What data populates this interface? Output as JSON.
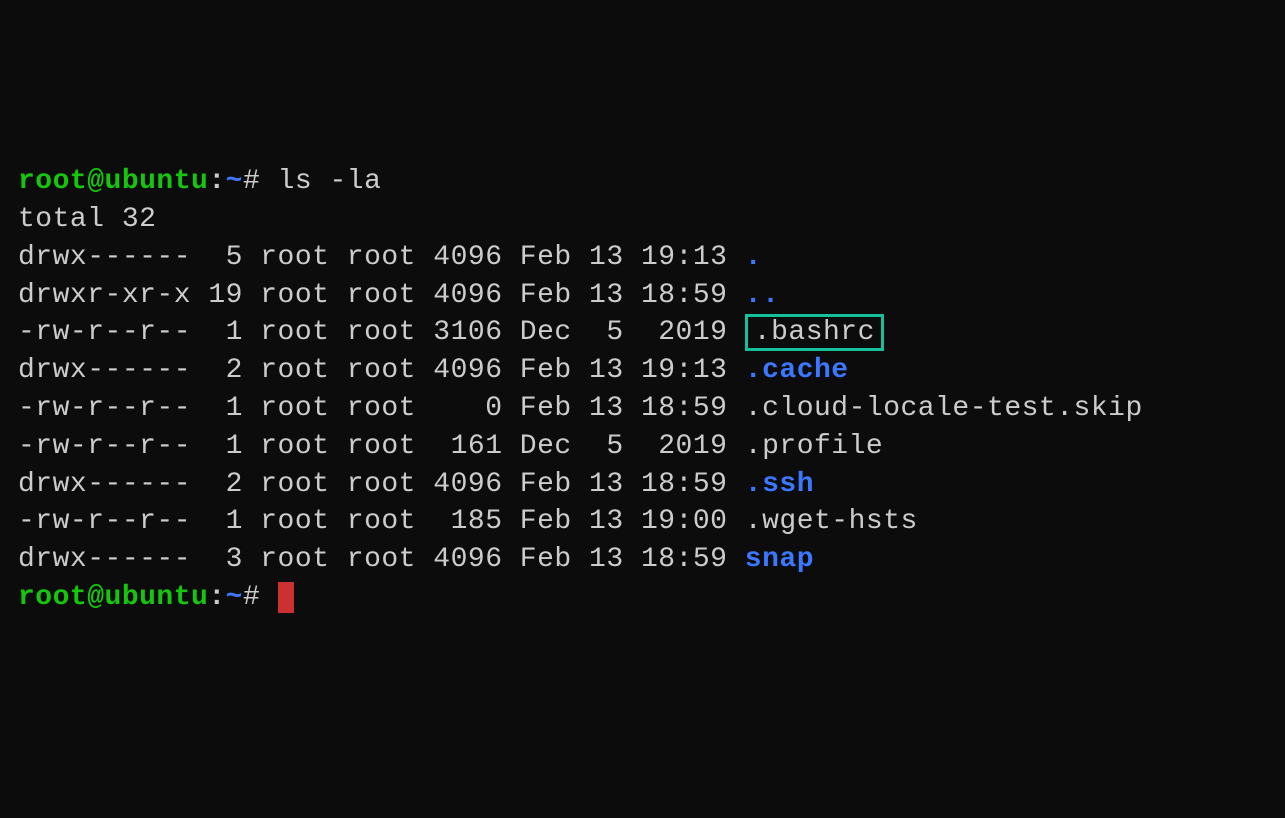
{
  "prompt": {
    "user_host": "root@ubuntu",
    "colon": ":",
    "path": "~",
    "symbol": "#"
  },
  "command": "ls -la",
  "total_line": "total 32",
  "rows": [
    {
      "perm": "drwx------",
      "links": " 5",
      "owner": "root",
      "group": "root",
      "size": "4096",
      "month": "Feb",
      "day": "13",
      "time": "19:13",
      "name": ".",
      "type": "dir",
      "highlight": false
    },
    {
      "perm": "drwxr-xr-x",
      "links": "19",
      "owner": "root",
      "group": "root",
      "size": "4096",
      "month": "Feb",
      "day": "13",
      "time": "18:59",
      "name": "..",
      "type": "dir",
      "highlight": false
    },
    {
      "perm": "-rw-r--r--",
      "links": " 1",
      "owner": "root",
      "group": "root",
      "size": "3106",
      "month": "Dec",
      "day": " 5",
      "time": " 2019",
      "name": ".bashrc",
      "type": "file",
      "highlight": true
    },
    {
      "perm": "drwx------",
      "links": " 2",
      "owner": "root",
      "group": "root",
      "size": "4096",
      "month": "Feb",
      "day": "13",
      "time": "19:13",
      "name": ".cache",
      "type": "dir",
      "highlight": false
    },
    {
      "perm": "-rw-r--r--",
      "links": " 1",
      "owner": "root",
      "group": "root",
      "size": "   0",
      "month": "Feb",
      "day": "13",
      "time": "18:59",
      "name": ".cloud-locale-test.skip",
      "type": "file",
      "highlight": false
    },
    {
      "perm": "-rw-r--r--",
      "links": " 1",
      "owner": "root",
      "group": "root",
      "size": " 161",
      "month": "Dec",
      "day": " 5",
      "time": " 2019",
      "name": ".profile",
      "type": "file",
      "highlight": false
    },
    {
      "perm": "drwx------",
      "links": " 2",
      "owner": "root",
      "group": "root",
      "size": "4096",
      "month": "Feb",
      "day": "13",
      "time": "18:59",
      "name": ".ssh",
      "type": "dir",
      "highlight": false
    },
    {
      "perm": "-rw-r--r--",
      "links": " 1",
      "owner": "root",
      "group": "root",
      "size": " 185",
      "month": "Feb",
      "day": "13",
      "time": "19:00",
      "name": ".wget-hsts",
      "type": "file",
      "highlight": false
    },
    {
      "perm": "drwx------",
      "links": " 3",
      "owner": "root",
      "group": "root",
      "size": "4096",
      "month": "Feb",
      "day": "13",
      "time": "18:59",
      "name": "snap",
      "type": "dir",
      "highlight": false
    }
  ]
}
